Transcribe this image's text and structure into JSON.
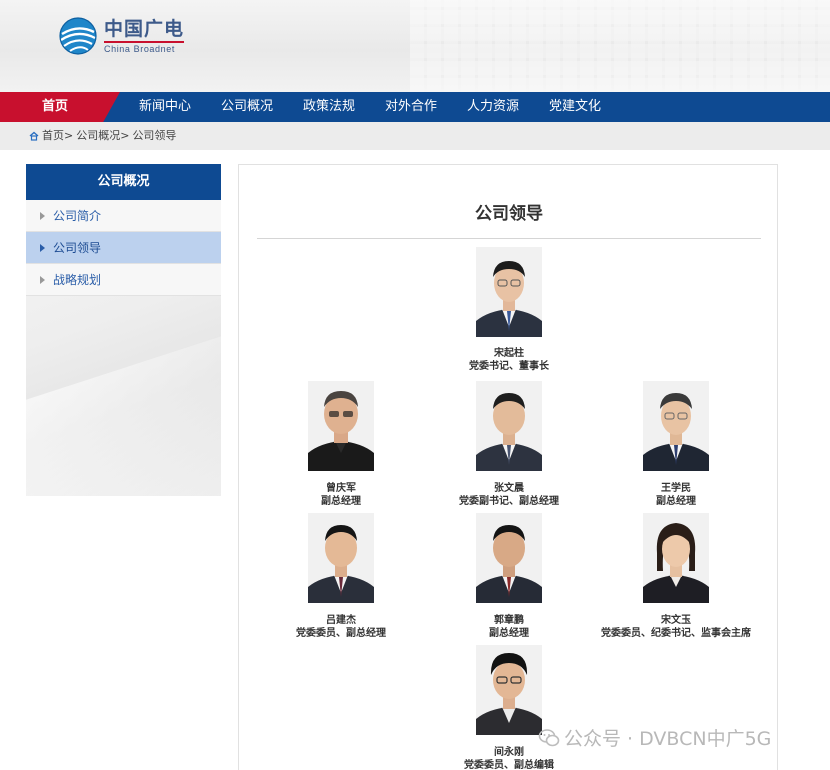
{
  "header": {
    "logo_cn": "中国广电",
    "logo_en": "China Broadnet"
  },
  "nav": {
    "items": [
      {
        "label": "首页"
      },
      {
        "label": "新闻中心"
      },
      {
        "label": "公司概况"
      },
      {
        "label": "政策法规"
      },
      {
        "label": "对外合作"
      },
      {
        "label": "人力资源"
      },
      {
        "label": "党建文化"
      }
    ],
    "active_color": "#c8102e",
    "bar_color": "#0e4a92"
  },
  "breadcrumb": {
    "items": [
      "首页>",
      "公司概况>",
      "公司领导"
    ]
  },
  "sidebar": {
    "title": "公司概况",
    "items": [
      {
        "label": "公司简介",
        "active": false
      },
      {
        "label": "公司领导",
        "active": true
      },
      {
        "label": "战略规划",
        "active": false
      }
    ]
  },
  "main": {
    "title": "公司领导",
    "leaders": [
      {
        "name": "宋起柱",
        "title": "党委书记、董事长"
      },
      {
        "name": "曾庆军",
        "title": "副总经理"
      },
      {
        "name": "张文晨",
        "title": "党委副书记、副总经理"
      },
      {
        "name": "王学民",
        "title": "副总经理"
      },
      {
        "name": "吕建杰",
        "title": "党委委员、副总经理"
      },
      {
        "name": "郭章鹏",
        "title": "副总经理"
      },
      {
        "name": "宋文玉",
        "title": "党委委员、纪委书记、监事会主席"
      },
      {
        "name": "间永刚",
        "title": "党委委员、副总编辑"
      }
    ]
  },
  "watermark": {
    "text": "公众号 · DVBCN中广5G"
  }
}
